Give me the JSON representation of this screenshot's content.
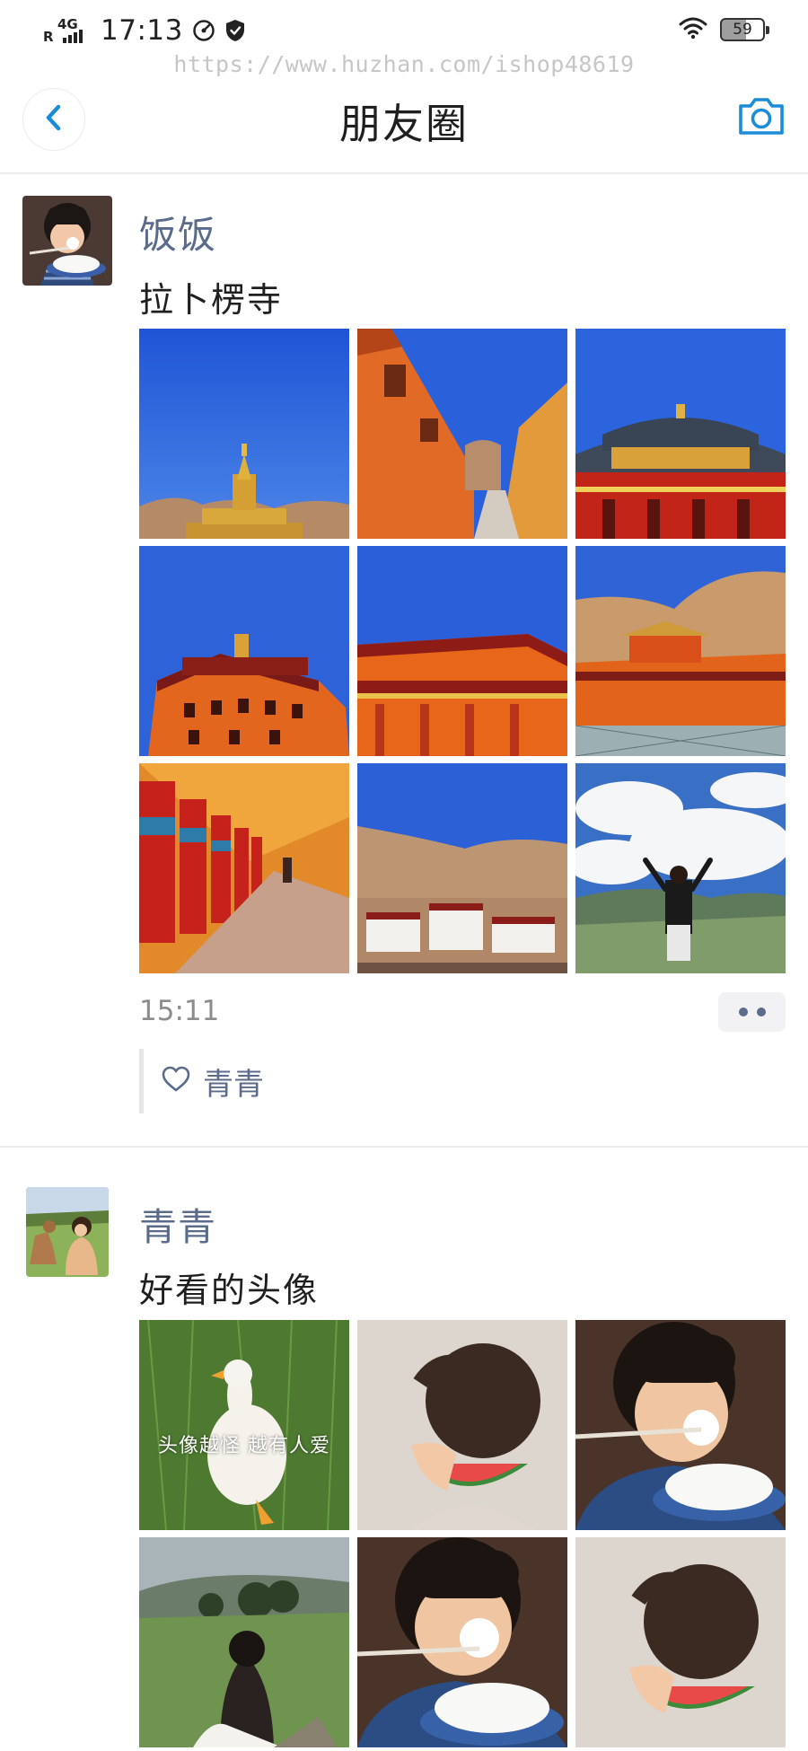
{
  "status_bar": {
    "network_type": "4G",
    "roaming": "R",
    "time": "17:13",
    "battery_level": "59"
  },
  "watermark": "https://www.huzhan.com/ishop48619",
  "nav": {
    "title": "朋友圈",
    "back_icon": "chevron-left-icon",
    "camera_icon": "camera-icon"
  },
  "colors": {
    "accent": "#1a8cd8",
    "username": "#5b6b8c",
    "meta_text": "#8c8c8c",
    "divider": "#ededed"
  },
  "posts": [
    {
      "username": "饭饭",
      "text": "拉卜楞寺",
      "time": "15:11",
      "likes": [
        "青青"
      ],
      "images": [
        "stupa-blue-sky",
        "red-wall-alley",
        "temple-roof",
        "red-tower-building",
        "temple-facade",
        "monastery-hills",
        "prayer-wheels-corridor",
        "hillside-monastery",
        "person-on-grassland"
      ]
    },
    {
      "username": "青青",
      "text": "好看的头像",
      "images": [
        "goose-on-grass",
        "girl-watermelon",
        "girl-eating-rice",
        "girl-on-meadow",
        "girl-eating-rice-2",
        "girl-watermelon-2"
      ],
      "image_caption": "头像越怪 越有人爱"
    }
  ]
}
